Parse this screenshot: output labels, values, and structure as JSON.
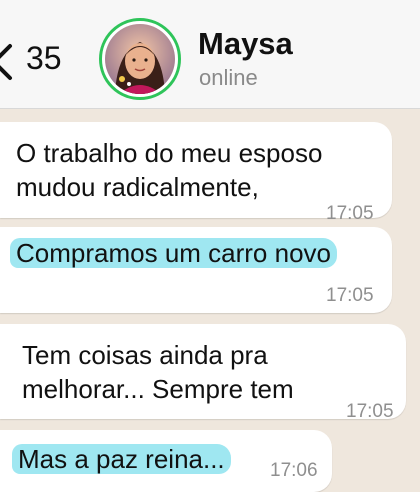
{
  "header": {
    "unread_count": "35",
    "contact_name": "Maysa",
    "contact_status": "online"
  },
  "messages": [
    {
      "lines": [
        "O trabalho do meu esposo",
        "mudou radicalmente,"
      ],
      "time": "17:05",
      "highlighted": false
    },
    {
      "lines": [
        "Compramos um carro novo"
      ],
      "time": "17:05",
      "highlighted": true
    },
    {
      "lines": [
        "Tem coisas ainda pra",
        "melhorar... Sempre tem"
      ],
      "time": "17:05",
      "highlighted": false
    },
    {
      "lines": [
        "Mas a paz reina..."
      ],
      "time": "17:06",
      "highlighted": true
    }
  ],
  "colors": {
    "highlight": "#9fe7f1",
    "online_ring": "#2fc45a",
    "chat_background": "#efe7dd",
    "bubble": "#ffffff"
  },
  "icons": {
    "back": "chevron-left-icon"
  }
}
